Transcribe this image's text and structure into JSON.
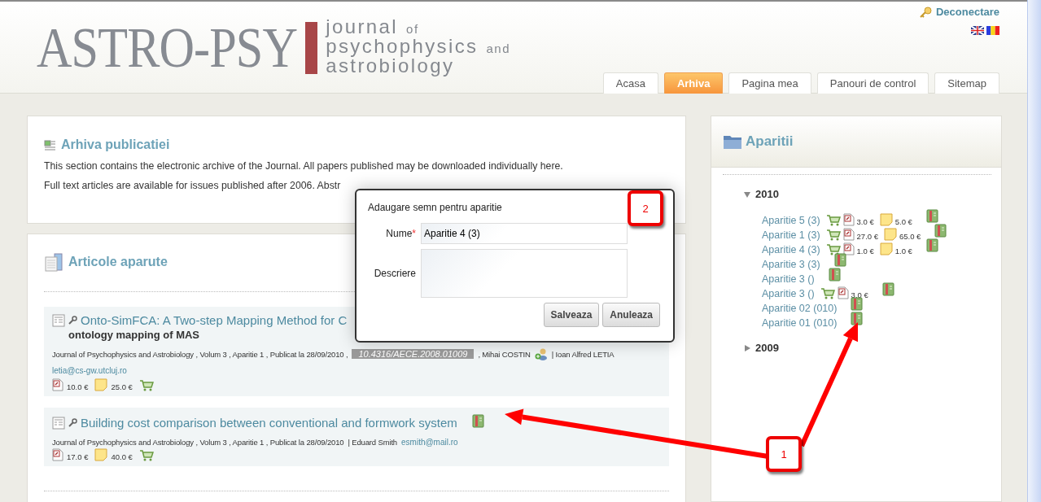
{
  "header": {
    "logo": "ASTRO-PSY",
    "tagline": [
      {
        "word": "journal",
        "connector": "of"
      },
      {
        "word": "psychophysics",
        "connector": "and"
      },
      {
        "word": "astrobiology"
      }
    ],
    "logout": "Deconectare"
  },
  "nav": [
    {
      "label": "Acasa",
      "selected": false
    },
    {
      "label": "Arhiva",
      "selected": true
    },
    {
      "label": "Pagina mea",
      "selected": false
    },
    {
      "label": "Panouri de control",
      "selected": false
    },
    {
      "label": "Sitemap",
      "selected": false
    }
  ],
  "intro": {
    "title": "Arhiva publicatiei",
    "paragraphs": [
      "This section contains the electronic archive of the Journal. All papers published may be downloaded individually here.",
      "Full text articles are available for issues published after 2006. Abstr"
    ]
  },
  "articles": {
    "title": "Articole aparute",
    "items": [
      {
        "title_lines": [
          "Onto-SimFCA: A Two-step Mapping Method for C",
          "ontology mapping of MAS"
        ],
        "meta": "Journal of Psychophysics and Astrobiology , Volum 3 , Aparitie 1 , Publicat la 28/09/2010 ,",
        "doi": "10.4316/AECE.2008.01009",
        "authors": [
          {
            "name": ", Mihai COSTIN",
            "add_icon": true
          },
          {
            "name": "| Ioan Alfred LETIA",
            "add_icon": false
          }
        ],
        "email": "letia@cs-gw.utcluj.ro",
        "pdf_price": "10.0 €",
        "print_price": "25.0 €",
        "cart": true,
        "bookmark": false
      },
      {
        "title_lines": [
          "Building cost comparison between conventional and formwork system"
        ],
        "meta": "Journal of Psychophysics and Astrobiology , Volum 3 , Aparitie 1 , Publicat la 28/09/2010",
        "authors": [
          {
            "name": "| Eduard Smith",
            "add_icon": false
          }
        ],
        "email": "esmith@mail.ro",
        "pdf_price": "17.0 €",
        "print_price": "40.0 €",
        "cart": true,
        "bookmark": true
      }
    ]
  },
  "sidebar": {
    "title": "Aparitii",
    "years": [
      {
        "year": "2010",
        "expanded": true,
        "children": [
          {
            "label": "Aparitie 5 (3)",
            "cart": true,
            "pdf_price": "3.0 €",
            "print_price": "5.0 €",
            "bookmark": true
          },
          {
            "label": "Aparitie 1 (3)",
            "cart": true,
            "pdf_price": "27.0 €",
            "print_price": "65.0 €",
            "bookmark": true
          },
          {
            "label": "Aparitie 4 (3)",
            "cart": true,
            "pdf_price": "1.0 €",
            "print_price": "1.0 €",
            "bookmark": true
          },
          {
            "label": "Aparitie 3 (3)",
            "cart": false,
            "bookmark": true
          },
          {
            "label": "Aparitie 3 ()",
            "cart": false,
            "bookmark": true
          },
          {
            "label": "Aparitie 3 ()",
            "cart": true,
            "pdf_price": "3.0 €",
            "bookmark": true
          },
          {
            "label": "Aparitie 02 (010)",
            "cart": false,
            "bookmark": true
          },
          {
            "label": "Aparitie 01 (010)",
            "cart": false,
            "bookmark": true
          }
        ]
      },
      {
        "year": "2009",
        "expanded": false
      }
    ]
  },
  "dialog": {
    "title": "Adaugare semn pentru aparitie",
    "fields": [
      {
        "label": "Nume",
        "required_mark": "*",
        "kind": "input",
        "value": "Aparitie 4 (3)"
      },
      {
        "label": "Descriere",
        "kind": "textarea"
      }
    ],
    "buttons": [
      "Salveaza",
      "Anuleaza"
    ]
  },
  "callouts": [
    {
      "label": "1"
    },
    {
      "label": "2"
    }
  ]
}
